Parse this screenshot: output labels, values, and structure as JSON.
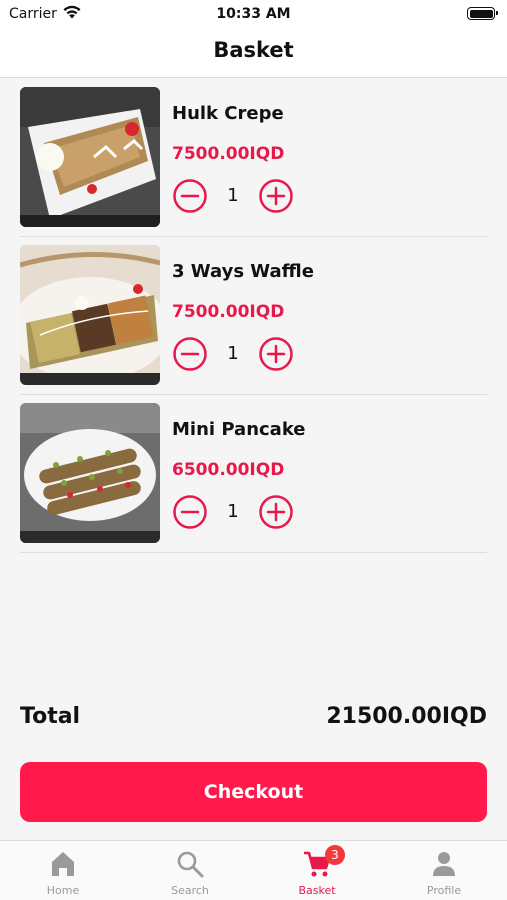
{
  "status_bar": {
    "carrier": "Carrier",
    "time": "10:33 AM"
  },
  "nav": {
    "title": "Basket"
  },
  "items": [
    {
      "name": "Hulk Crepe",
      "price": "7500.00IQD",
      "quantity": "1",
      "image": "crepe-photo"
    },
    {
      "name": "3 Ways Waffle",
      "price": "7500.00IQD",
      "quantity": "1",
      "image": "waffle-photo"
    },
    {
      "name": "Mini Pancake",
      "price": "6500.00IQD",
      "quantity": "1",
      "image": "pancake-photo"
    }
  ],
  "summary": {
    "total_label": "Total",
    "total_value": "21500.00IQD"
  },
  "checkout_label": "Checkout",
  "tabs": [
    {
      "label": "Home",
      "icon": "home-icon"
    },
    {
      "label": "Search",
      "icon": "search-icon"
    },
    {
      "label": "Basket",
      "icon": "cart-icon",
      "badge": "3",
      "active": true
    },
    {
      "label": "Profile",
      "icon": "person-icon"
    }
  ],
  "colors": {
    "accent": "#ff1a4b",
    "price": "#e8194a",
    "badge": "#f03a3a",
    "inactive": "#999999"
  }
}
